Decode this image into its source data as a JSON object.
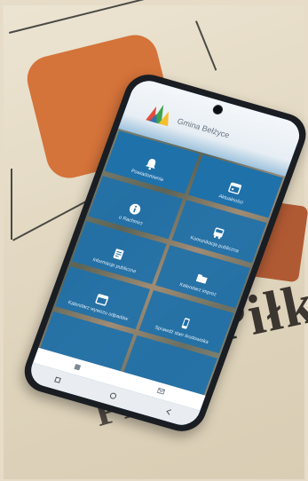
{
  "app": {
    "title": "Gmina Bełżyce"
  },
  "tiles": [
    {
      "label": "Powiadomienia",
      "icon": "bell-icon"
    },
    {
      "label": "Aktualności",
      "icon": "calendar-icon"
    },
    {
      "label": "o Rachmirz",
      "icon": "info-icon"
    },
    {
      "label": "Komunikacja publiczna",
      "icon": "bus-icon"
    },
    {
      "label": "Informacje publiczne",
      "icon": "document-icon"
    },
    {
      "label": "Kalendarz imprez",
      "icon": "folder-icon"
    },
    {
      "label": "Kalendarz wywozu odpadów",
      "icon": "calendar-icon"
    },
    {
      "label": "Sprawdź stan środowiska",
      "icon": "phone-icon"
    }
  ],
  "print": {
    "big_word": "Piłku",
    "bottom_word": "PIL"
  },
  "colors": {
    "tile": "#1f71aa",
    "orange": "#d4733a",
    "phone": "#1a1d22"
  }
}
